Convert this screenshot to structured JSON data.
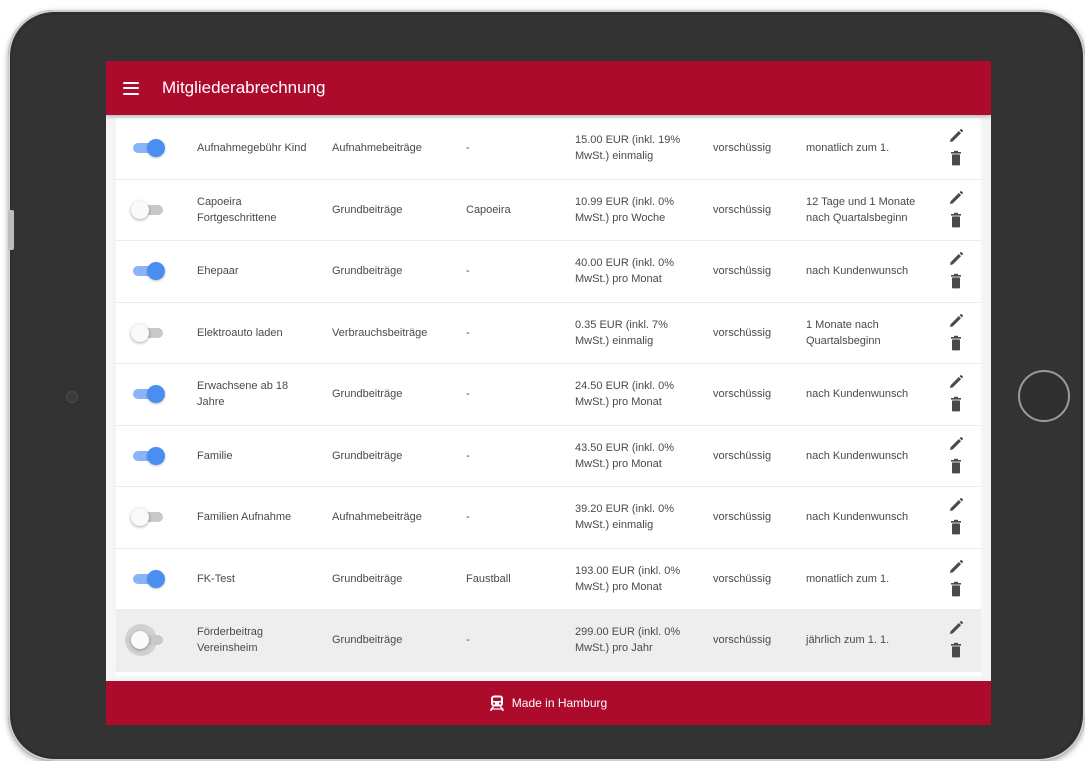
{
  "app_bar": {
    "title": "Mitgliederabrechnung"
  },
  "colors": {
    "brand_red": "#ad0b2c",
    "toggle_on": "#4b8ef1",
    "toggle_off": "#fafafa"
  },
  "rows": [
    {
      "active": true,
      "name": "Aufnahmegebühr Kind",
      "group": "Aufnahmebeiträge",
      "sub": "-",
      "price": "15.00 EUR (inkl. 19% MwSt.) einmalig",
      "payment": "vorschüssig",
      "time": "monatlich zum 1."
    },
    {
      "active": false,
      "name": "Capoeira Fortgeschrittene",
      "group": "Grundbeiträge",
      "sub": "Capoeira",
      "price": "10.99 EUR (inkl. 0% MwSt.) pro Woche",
      "payment": "vorschüssig",
      "time": "12 Tage und 1 Monate nach Quartalsbeginn"
    },
    {
      "active": true,
      "name": "Ehepaar",
      "group": "Grundbeiträge",
      "sub": "-",
      "price": "40.00 EUR (inkl. 0% MwSt.) pro Monat",
      "payment": "vorschüssig",
      "time": "nach Kundenwunsch"
    },
    {
      "active": false,
      "name": "Elektroauto laden",
      "group": "Verbrauchsbeiträge",
      "sub": "-",
      "price": "0.35 EUR (inkl. 7% MwSt.) einmalig",
      "payment": "vorschüssig",
      "time": "1 Monate nach Quartalsbeginn"
    },
    {
      "active": true,
      "name": "Erwachsene ab 18 Jahre",
      "group": "Grundbeiträge",
      "sub": "-",
      "price": "24.50 EUR (inkl. 0% MwSt.) pro Monat",
      "payment": "vorschüssig",
      "time": "nach Kundenwunsch"
    },
    {
      "active": true,
      "name": "Familie",
      "group": "Grundbeiträge",
      "sub": "-",
      "price": "43.50 EUR (inkl. 0% MwSt.) pro Monat",
      "payment": "vorschüssig",
      "time": "nach Kundenwunsch"
    },
    {
      "active": false,
      "name": "Familien Aufnahme",
      "group": "Aufnahmebeiträge",
      "sub": "-",
      "price": "39.20 EUR (inkl. 0% MwSt.) einmalig",
      "payment": "vorschüssig",
      "time": "nach Kundenwunsch"
    },
    {
      "active": true,
      "name": "FK-Test",
      "group": "Grundbeiträge",
      "sub": "Faustball",
      "price": "193.00 EUR (inkl. 0% MwSt.) pro Monat",
      "payment": "vorschüssig",
      "time": "monatlich zum 1."
    },
    {
      "active": false,
      "name": "Förderbeitrag Vereinsheim",
      "group": "Grundbeiträge",
      "sub": "-",
      "price": "299.00 EUR (inkl. 0% MwSt.) pro Jahr",
      "payment": "vorschüssig",
      "time": "jährlich zum 1. 1."
    }
  ],
  "highlighted_row": 8,
  "icons": {
    "menu": "menu-icon",
    "edit": "edit-icon",
    "delete": "delete-icon",
    "footer": "train-icon"
  },
  "footer": {
    "text": "Made in Hamburg"
  }
}
